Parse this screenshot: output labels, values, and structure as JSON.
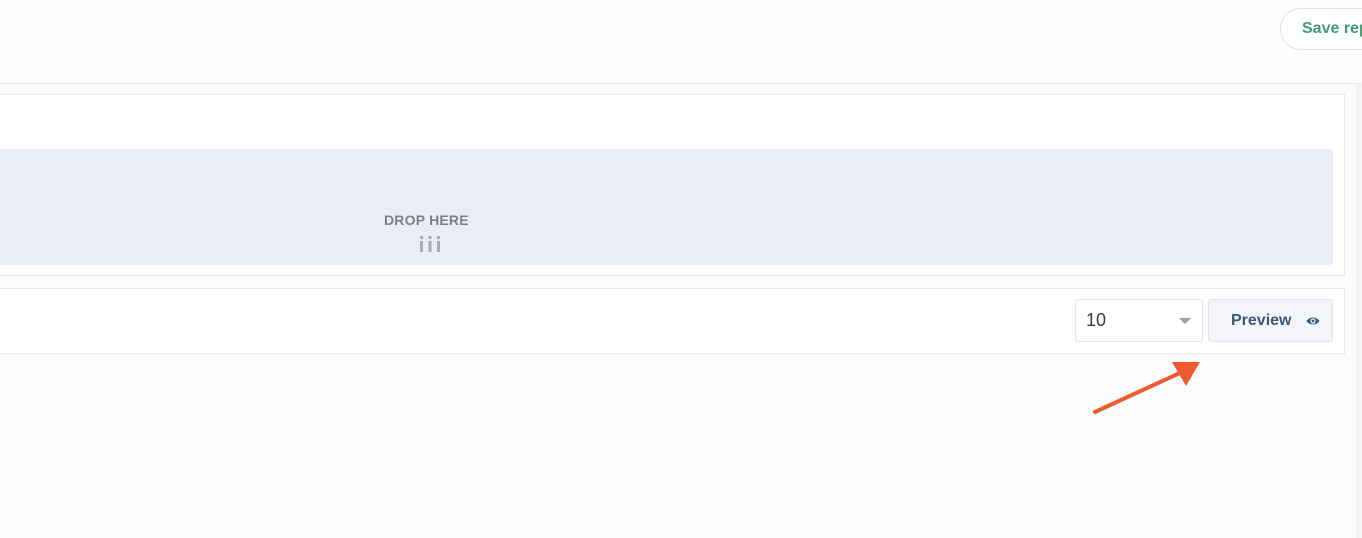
{
  "header": {
    "save_button_label": "Save rep"
  },
  "drop_zone": {
    "label": "DROP HERE",
    "handle_icon": "grip-vertical-icon"
  },
  "preview_bar": {
    "rows_select_value": "10",
    "caret_icon": "caret-down-icon",
    "preview_button_label": "Preview",
    "preview_icon": "eye-icon"
  },
  "annotation": {
    "arrow_color": "#ef5a2f"
  }
}
